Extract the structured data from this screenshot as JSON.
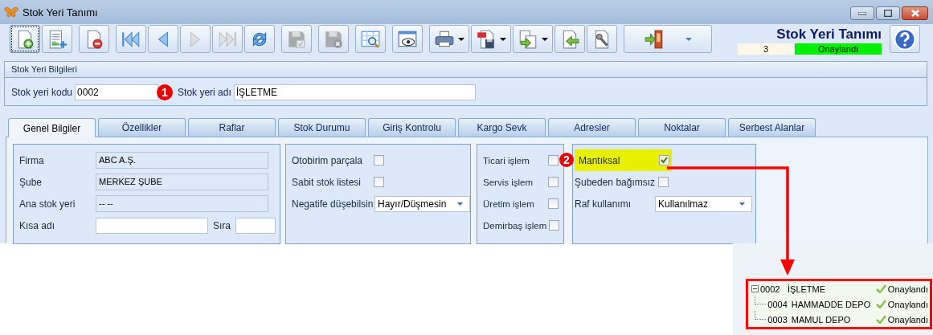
{
  "window": {
    "title": "Stok Yeri Tanımı"
  },
  "toolbar": [
    [
      {
        "kind": "new",
        "disabled": false,
        "focused": true,
        "dropdown": false
      },
      {
        "kind": "add-list",
        "disabled": false,
        "focused": false,
        "dropdown": false
      }
    ],
    [
      {
        "kind": "delete",
        "disabled": false,
        "focused": false,
        "dropdown": false
      }
    ],
    [
      {
        "kind": "first",
        "disabled": false,
        "focused": false,
        "dropdown": false
      },
      {
        "kind": "prev",
        "disabled": false,
        "focused": false,
        "dropdown": false
      },
      {
        "kind": "next",
        "disabled": true,
        "focused": false,
        "dropdown": false
      },
      {
        "kind": "last",
        "disabled": true,
        "focused": false,
        "dropdown": false
      },
      {
        "kind": "refresh",
        "disabled": false,
        "focused": false,
        "dropdown": false
      }
    ],
    [
      {
        "kind": "save",
        "disabled": true,
        "focused": false,
        "dropdown": false
      }
    ],
    [
      {
        "kind": "save-cancel",
        "disabled": true,
        "focused": false,
        "dropdown": false
      }
    ],
    [
      {
        "kind": "grid-search",
        "disabled": false,
        "focused": false,
        "dropdown": false
      }
    ],
    [
      {
        "kind": "preview",
        "disabled": false,
        "focused": false,
        "dropdown": false
      }
    ],
    [
      {
        "kind": "print",
        "disabled": false,
        "focused": false,
        "dropdown": true
      },
      {
        "kind": "pdf",
        "disabled": false,
        "focused": false,
        "dropdown": true
      },
      {
        "kind": "copy",
        "disabled": false,
        "focused": false,
        "dropdown": true
      },
      {
        "kind": "import",
        "disabled": false,
        "focused": false,
        "dropdown": false
      },
      {
        "kind": "tools",
        "disabled": false,
        "focused": false,
        "dropdown": false
      }
    ],
    [
      {
        "kind": "exit",
        "disabled": false,
        "focused": false,
        "dropdown": true
      }
    ]
  ],
  "header": {
    "title": "Stok Yeri Tanımı",
    "number": "3",
    "status": "Onaylandı"
  },
  "info_group": {
    "title": "Stok Yeri Bilgileri",
    "code_label": "Stok yeri kodu",
    "code_value": "0002",
    "name_label": "Stok yeri adı",
    "name_value": "İŞLETME"
  },
  "tabs": [
    {
      "label": "Genel Bilgiler",
      "selected": true
    },
    {
      "label": "Özellikler",
      "selected": false
    },
    {
      "label": "Raflar",
      "selected": false
    },
    {
      "label": "Stok Durumu",
      "selected": false
    },
    {
      "label": "Giriş Kontrolu",
      "selected": false
    },
    {
      "label": "Kargo Sevk",
      "selected": false
    },
    {
      "label": "Adresler",
      "selected": false
    },
    {
      "label": "Noktalar",
      "selected": false
    },
    {
      "label": "Serbest Alanlar",
      "selected": false
    }
  ],
  "panels": [
    {
      "fields": [
        {
          "kind": "readonly",
          "label": "Firma",
          "value": "ABC A.Ş."
        },
        {
          "kind": "readonly",
          "label": "Şube",
          "value": "MERKEZ ŞUBE"
        },
        {
          "kind": "readonly",
          "label": "Ana stok yeri",
          "value": "-- --"
        },
        {
          "kind": "input",
          "label": "Kısa adı",
          "extra_label": "Sıra"
        }
      ]
    },
    {
      "fields": [
        {
          "kind": "check",
          "label": "Otobirim parçala",
          "checked": false,
          "highlighted": false
        },
        {
          "kind": "check",
          "label": "Sabit stok listesi",
          "checked": false,
          "highlighted": false
        },
        {
          "kind": "select",
          "label": "Negatife düşebilsin",
          "value": "Hayır/Düşmesin"
        }
      ]
    },
    {
      "fields": [
        {
          "kind": "check",
          "label": "Ticari işlem",
          "checked": false,
          "highlighted": false
        },
        {
          "kind": "check",
          "label": "Servis işlem",
          "checked": false,
          "highlighted": false
        },
        {
          "kind": "check",
          "label": "Üretim işlem",
          "checked": false,
          "highlighted": false
        },
        {
          "kind": "check",
          "label": "Demirbaş işlem",
          "checked": false,
          "highlighted": false
        }
      ]
    },
    {
      "fields": [
        {
          "kind": "check",
          "label": "Mantıksal",
          "checked": true,
          "highlighted": true
        },
        {
          "kind": "check",
          "label": "Şubeden bağımsız",
          "checked": false,
          "highlighted": false
        },
        {
          "kind": "select",
          "label": "Raf kullanımı",
          "value": "Kullanılmaz"
        }
      ]
    }
  ],
  "tree": [
    {
      "code": "0002",
      "name": "İŞLETME",
      "status": "Onaylandı",
      "expanded": true,
      "children": [
        {
          "code": "0004",
          "name": "HAMMADDE DEPO",
          "status": "Onaylandı"
        },
        {
          "code": "0003",
          "name": "MAMUL DEPO",
          "status": "Onaylandı"
        }
      ]
    }
  ],
  "annotations": [
    "1",
    "2"
  ]
}
